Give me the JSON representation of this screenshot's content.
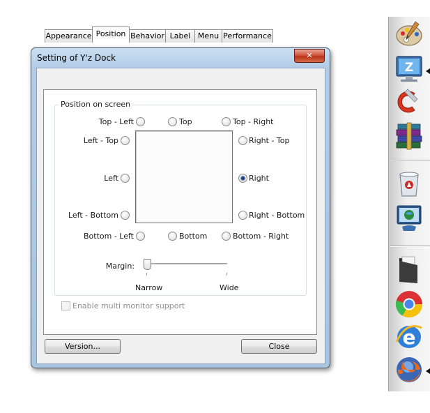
{
  "window": {
    "title": "Setting of Y'z Dock",
    "close_glyph": "✕"
  },
  "tabs": [
    {
      "label": "Appearance",
      "active": false
    },
    {
      "label": "Position",
      "active": true
    },
    {
      "label": "Behavior",
      "active": false
    },
    {
      "label": "Label",
      "active": false
    },
    {
      "label": "Menu",
      "active": false
    },
    {
      "label": "Performance",
      "active": false
    }
  ],
  "position": {
    "group_label": "Position on screen",
    "options": {
      "top_left": "Top - Left",
      "top": "Top",
      "top_right": "Top - Right",
      "left_top": "Left - Top",
      "left": "Left",
      "left_bottom": "Left - Bottom",
      "right_top": "Right - Top",
      "right": "Right",
      "right_bottom": "Right - Bottom",
      "bottom_left": "Bottom - Left",
      "bottom": "Bottom",
      "bottom_right": "Bottom - Right"
    },
    "selected": "Right"
  },
  "margin": {
    "label": "Margin:",
    "min_label": "Narrow",
    "max_label": "Wide",
    "value_fraction": 0.0
  },
  "multi_monitor": {
    "label": "Enable multi monitor support",
    "checked": false,
    "enabled": false
  },
  "buttons": {
    "version": "Version...",
    "close": "Close"
  },
  "dock": {
    "icons": [
      "paint-palette-icon",
      "yz-dock-monitor-icon",
      "ccleaner-icon",
      "winrar-books-icon",
      "recycle-bin-icon",
      "network-monitor-icon",
      "documents-folder-icon",
      "chrome-icon",
      "internet-explorer-icon",
      "firefox-icon"
    ],
    "running": [
      "yz-dock-monitor-icon",
      "firefox-icon"
    ]
  },
  "colors": {
    "title_gradient_top": "#c9dff2",
    "close_button": "#c0432b",
    "selected_radio": "#1d3f78"
  }
}
